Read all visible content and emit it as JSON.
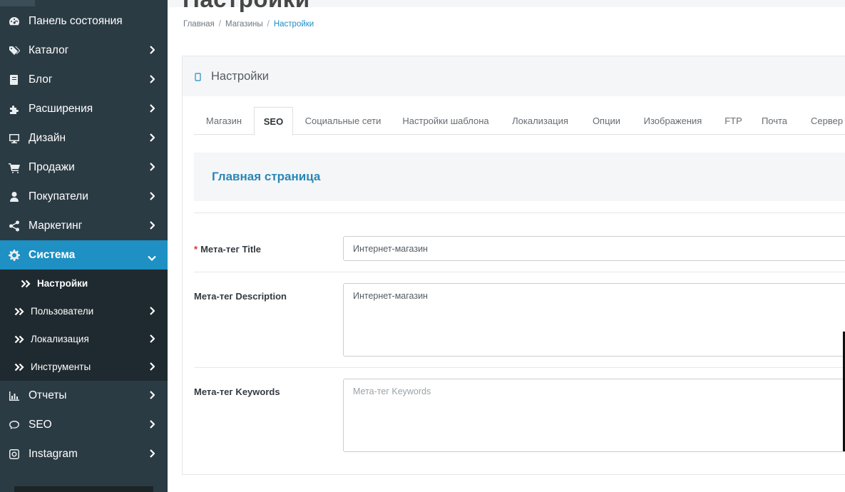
{
  "sidebar": {
    "items": [
      {
        "label": "Панель состояния",
        "icon": "dashboard-icon"
      },
      {
        "label": "Каталог",
        "icon": "tags-icon"
      },
      {
        "label": "Блог",
        "icon": "book-icon"
      },
      {
        "label": "Расширения",
        "icon": "puzzle-icon"
      },
      {
        "label": "Дизайн",
        "icon": "desktop-icon"
      },
      {
        "label": "Продажи",
        "icon": "cart-icon"
      },
      {
        "label": "Покупатели",
        "icon": "user-icon"
      },
      {
        "label": "Маркетинг",
        "icon": "share-icon"
      },
      {
        "label": "Система",
        "icon": "gear-icon"
      },
      {
        "label": "Отчеты",
        "icon": "bar-chart-icon"
      },
      {
        "label": "SEO",
        "icon": "comment-icon"
      },
      {
        "label": "Instagram",
        "icon": "instagram-icon"
      }
    ],
    "subitems": [
      {
        "label": "Настройки"
      },
      {
        "label": "Пользователи"
      },
      {
        "label": "Локализация"
      },
      {
        "label": "Инструменты"
      }
    ]
  },
  "header": {
    "title": "Настройки",
    "breadcrumb": [
      "Главная",
      "Магазины",
      "Настройки"
    ],
    "separator": "/"
  },
  "panel": {
    "title": "Настройки",
    "tabs": [
      "Магазин",
      "SEO",
      "Социальные сети",
      "Настройки шаблона",
      "Локализация",
      "Опции",
      "Изображения",
      "FTP",
      "Почта",
      "Сервер"
    ],
    "active_tab": "SEO",
    "section_title": "Главная страница",
    "fields": {
      "meta_title": {
        "label": "Мета-тег Title",
        "required_mark": "*",
        "value": "Интернет-магазин"
      },
      "meta_description": {
        "label": "Мета-тег Description",
        "value": "Интернет-магазин"
      },
      "meta_keywords": {
        "label": "Мета-тег Keywords",
        "value": "",
        "placeholder": "Мета-тег Keywords"
      }
    }
  },
  "colors": {
    "sidebar_bg": "#2b3b44",
    "sidebar_active": "#1e90c3",
    "submenu_bg": "#1f2a30",
    "accent": "#1e8ec2",
    "required": "#e52d2d"
  }
}
